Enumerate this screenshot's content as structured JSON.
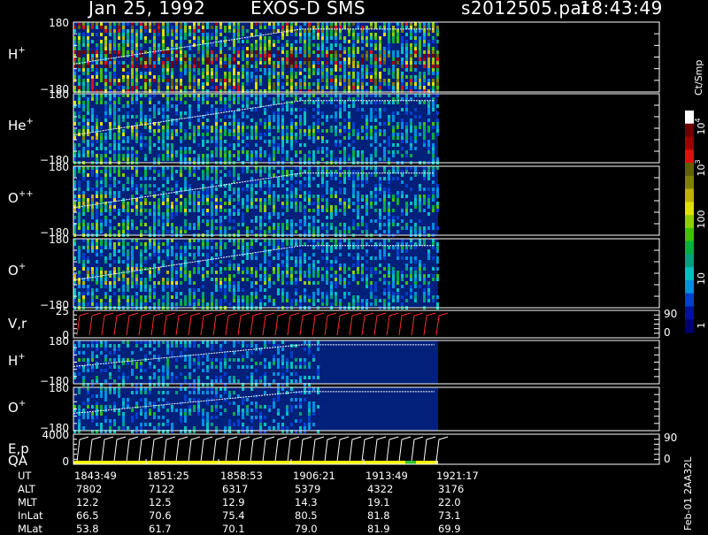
{
  "header": {
    "date": "Jan 25, 1992",
    "instrument": "EXOS-D SMS",
    "file": "s2012505.par",
    "time": "18:43:49"
  },
  "side_label": "Feb-01 2AA32L",
  "colors": {
    "background": "#000000",
    "axes": "#ffffff",
    "panel_fill": "#00207a",
    "trace": "#ffffff",
    "vr_trace": "#ff2a2a",
    "flag_bar": "#ffff00"
  },
  "chart_data": {
    "type": "heatmap",
    "title": "Jan 25, 1992   EXOS-D SMS",
    "time_ticks": [
      "1843:49",
      "1851:25",
      "1858:53",
      "1906:21",
      "1913:49",
      "1921:17"
    ],
    "panels": [
      {
        "label": "H",
        "sup": "+",
        "ymax": "180",
        "ymin": "−180",
        "intensity": "high"
      },
      {
        "label": "He",
        "sup": "+",
        "ymax": "180",
        "ymin": "−180",
        "intensity": "medium"
      },
      {
        "label": "O",
        "sup": "++",
        "ymax": "180",
        "ymin": "−180",
        "intensity": "medium"
      },
      {
        "label": "O",
        "sup": "+",
        "ymax": "180",
        "ymin": "−180",
        "intensity": "medium"
      },
      {
        "label": "V,r",
        "sup": "",
        "ymax": "25",
        "ymin": "0",
        "right_max": "90",
        "right_min": "0",
        "intensity": "line"
      },
      {
        "label": "H",
        "sup": "+",
        "ymax": "180",
        "ymin": "−180",
        "intensity": "low"
      },
      {
        "label": "O",
        "sup": "+",
        "ymax": "180",
        "ymin": "−180",
        "intensity": "low"
      },
      {
        "label": "E,p",
        "label2": "QA",
        "sup": "",
        "ymax": "4000",
        "ymin": "0",
        "right_max": "90",
        "right_min": "0",
        "intensity": "line"
      }
    ],
    "colorbar": {
      "unit": "Ct/Smp",
      "labels": [
        "1",
        "10",
        "100",
        "10",
        "10"
      ],
      "label_exponents": [
        "",
        "",
        "",
        "3",
        "4"
      ],
      "colors": [
        "#000070",
        "#0010a0",
        "#0040d0",
        "#0090e0",
        "#00c0c0",
        "#00a080",
        "#00b040",
        "#40c000",
        "#90d000",
        "#e0e000",
        "#c0b000",
        "#808000",
        "#606000",
        "#e01010",
        "#a00000",
        "#700000",
        "#ffffff"
      ]
    },
    "ephemeris": {
      "rows": [
        {
          "name": "UT",
          "values": [
            "1843:49",
            "1851:25",
            "1858:53",
            "1906:21",
            "1913:49",
            "1921:17"
          ]
        },
        {
          "name": "ALT",
          "values": [
            "7802",
            "7122",
            "6317",
            "5379",
            "4322",
            "3176"
          ]
        },
        {
          "name": "MLT",
          "values": [
            "12.2",
            "12.5",
            "12.9",
            "14.3",
            "19.1",
            "22.0"
          ]
        },
        {
          "name": "InLat",
          "values": [
            "66.5",
            "70.6",
            "75.4",
            "80.5",
            "81.8",
            "73.1"
          ]
        },
        {
          "name": "MLat",
          "values": [
            "53.8",
            "61.7",
            "70.1",
            "79.0",
            "81.9",
            "69.9"
          ]
        }
      ]
    }
  }
}
